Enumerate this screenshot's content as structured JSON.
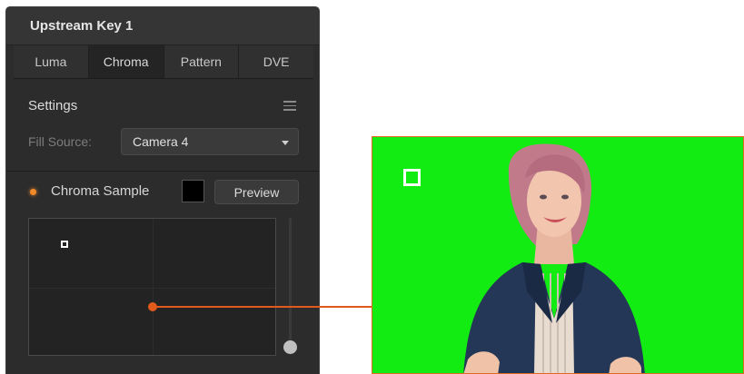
{
  "panel": {
    "title": "Upstream Key 1",
    "tabs": [
      {
        "label": "Luma",
        "active": false
      },
      {
        "label": "Chroma",
        "active": true
      },
      {
        "label": "Pattern",
        "active": false
      },
      {
        "label": "DVE",
        "active": false
      }
    ],
    "settings_title": "Settings",
    "fill_source": {
      "label": "Fill Source:",
      "value": "Camera 4"
    },
    "chroma_sample": {
      "label": "Chroma Sample",
      "swatch_color": "#000000",
      "preview_label": "Preview"
    }
  },
  "colors": {
    "accent_orange": "#e05a1b",
    "green_screen": "#12ec12",
    "panel_bg": "#2c2c2c"
  },
  "icons": [
    "menu-icon",
    "chevron-down-icon",
    "status-dot-icon"
  ]
}
